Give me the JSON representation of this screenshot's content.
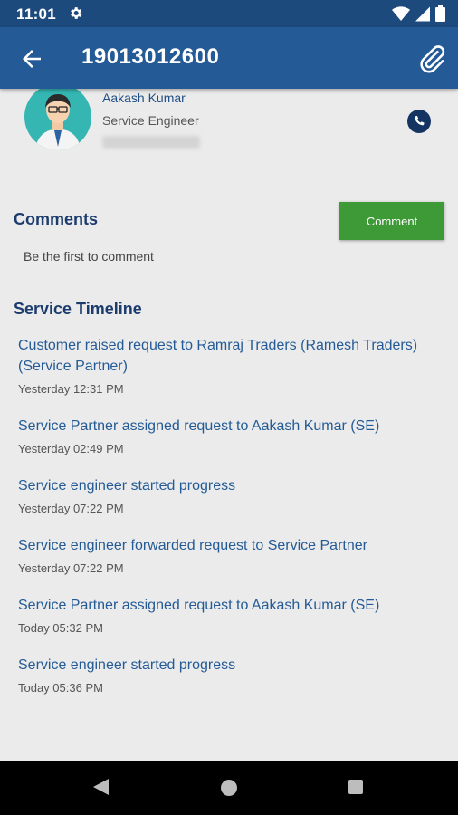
{
  "status_bar": {
    "time": "11:01"
  },
  "app_bar": {
    "title": "19013012600"
  },
  "profile": {
    "name": "Aakash Kumar",
    "role": "Service Engineer"
  },
  "comments": {
    "heading": "Comments",
    "button_label": "Comment",
    "empty_message": "Be the first to comment"
  },
  "timeline": {
    "heading": "Service Timeline",
    "items": [
      {
        "text": "Customer raised request  to Ramraj Traders (Ramesh Traders) (Service Partner)",
        "time": "Yesterday 12:31 PM"
      },
      {
        "text": "Service Partner assigned request to Aakash Kumar (SE)",
        "time": "Yesterday 02:49 PM"
      },
      {
        "text": "Service engineer started progress",
        "time": "Yesterday 07:22 PM"
      },
      {
        "text": "Service engineer forwarded request to Service Partner",
        "time": "Yesterday 07:22 PM"
      },
      {
        "text": "Service Partner assigned request to Aakash Kumar (SE)",
        "time": "Today 05:32 PM"
      },
      {
        "text": "Service engineer started progress",
        "time": "Today 05:36 PM"
      }
    ]
  },
  "colors": {
    "status_bar": "#1c4a7d",
    "app_bar": "#245b96",
    "accent_green": "#3e9a36",
    "link_blue": "#245b96",
    "heading_navy": "#1c3c6e"
  }
}
